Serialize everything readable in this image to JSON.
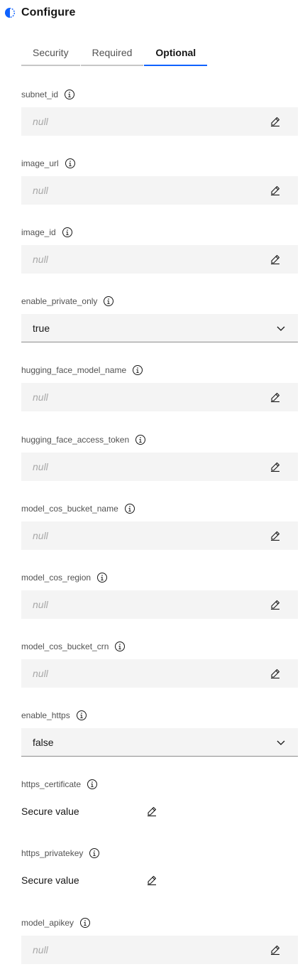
{
  "header": {
    "title": "Configure",
    "status_icon": "half-circle-status-icon",
    "status_color": "#0f62fe"
  },
  "tabs": [
    {
      "label": "Security",
      "active": false
    },
    {
      "label": "Required",
      "active": false
    },
    {
      "label": "Optional",
      "active": true
    }
  ],
  "fields": {
    "subnet_id": {
      "label": "subnet_id",
      "placeholder": "null"
    },
    "image_url": {
      "label": "image_url",
      "placeholder": "null"
    },
    "image_id": {
      "label": "image_id",
      "placeholder": "null"
    },
    "enable_private_only": {
      "label": "enable_private_only",
      "value": "true"
    },
    "hugging_face_model_name": {
      "label": "hugging_face_model_name",
      "placeholder": "null"
    },
    "hugging_face_access_token": {
      "label": "hugging_face_access_token",
      "placeholder": "null"
    },
    "model_cos_bucket_name": {
      "label": "model_cos_bucket_name",
      "placeholder": "null"
    },
    "model_cos_region": {
      "label": "model_cos_region",
      "placeholder": "null"
    },
    "model_cos_bucket_crn": {
      "label": "model_cos_bucket_crn",
      "placeholder": "null"
    },
    "enable_https": {
      "label": "enable_https",
      "value": "false"
    },
    "https_certificate": {
      "label": "https_certificate",
      "value": "Secure value"
    },
    "https_privatekey": {
      "label": "https_privatekey",
      "value": "Secure value"
    },
    "model_apikey": {
      "label": "model_apikey",
      "placeholder": "null"
    }
  },
  "icons": {
    "info": "info-icon",
    "edit": "edit-pencil-icon",
    "chevron": "chevron-down-icon"
  },
  "colors": {
    "accent": "#0f62fe",
    "field_bg": "#f4f4f4",
    "label": "#525252",
    "placeholder": "#a8a8a8"
  }
}
